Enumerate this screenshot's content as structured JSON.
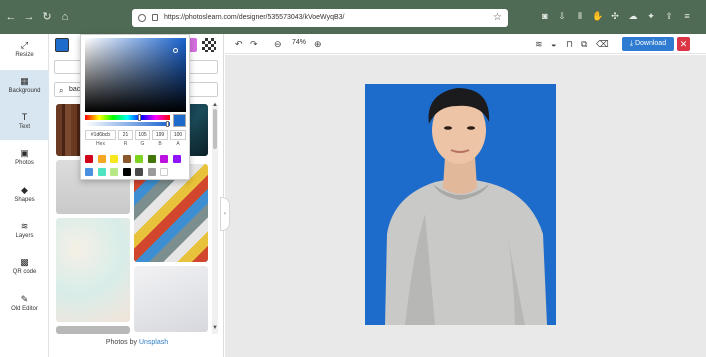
{
  "browser": {
    "url": "https://photoslearn.com/designer/535573043/kVoeWyqB3/",
    "back": "←",
    "forward": "→",
    "reload": "↻",
    "home": "⌂",
    "bookmark_star": "☆"
  },
  "rail": {
    "items": [
      {
        "label": "Resize",
        "icon": "resize-icon",
        "glyph": "⤢"
      },
      {
        "label": "Background",
        "icon": "background-grid-icon",
        "glyph": "▦"
      },
      {
        "label": "Text",
        "icon": "text-icon",
        "glyph": "T"
      },
      {
        "label": "Photos",
        "icon": "photo-icon",
        "glyph": "▣"
      },
      {
        "label": "Shapes",
        "icon": "shapes-icon",
        "glyph": "◆"
      },
      {
        "label": "Layers",
        "icon": "layers-icon",
        "glyph": "≋"
      },
      {
        "label": "QR code",
        "icon": "qr-icon",
        "glyph": "▩"
      },
      {
        "label": "Old Editor",
        "icon": "edit-icon",
        "glyph": "✎"
      }
    ],
    "active_index": 1
  },
  "panel": {
    "search_value": "bac",
    "credit_prefix": "Photos by ",
    "credit_link": "Unsplash",
    "scroll_up": "▲",
    "scroll_down": "▼"
  },
  "picker": {
    "hex": "#1d6bcb",
    "r": "21",
    "g": "105",
    "b": "199",
    "a": "100",
    "labels": [
      "Hex",
      "R",
      "G",
      "B",
      "A"
    ],
    "presets": [
      "#d0021b",
      "#f5a623",
      "#f8e71c",
      "#8b572a",
      "#7ed321",
      "#417505",
      "#bd10e0",
      "#9013fe",
      "#4a90e2",
      "#50e3c2",
      "#b8e986",
      "#000000",
      "#4a4a4a",
      "#9b9b9b",
      "#ffffff"
    ]
  },
  "toolbar": {
    "zoom": "74%",
    "download_label": "Download",
    "close_label": "✕",
    "undo": "↶",
    "redo": "↷",
    "zoom_out": "⊖",
    "zoom_in": "⊕"
  },
  "colors": {
    "chrome": "#4f6b55",
    "accent": "#2e7bd1",
    "canvas_bg": "#1d6bcb",
    "danger": "#dc3545"
  }
}
